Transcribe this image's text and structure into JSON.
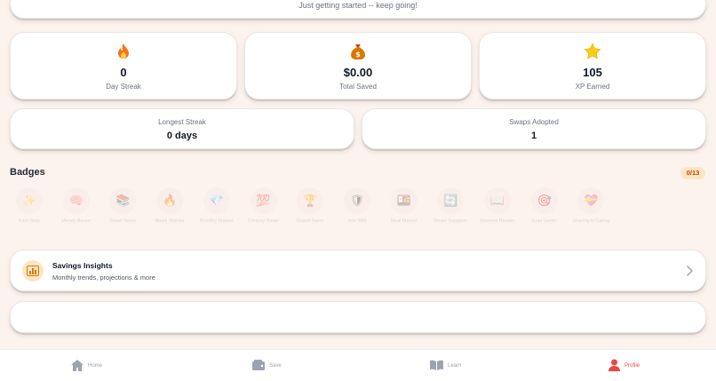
{
  "header": {
    "message": "Just getting started -- keep going!"
  },
  "stats": [
    {
      "icon": "flame-icon",
      "value": "0",
      "label": "Day Streak"
    },
    {
      "icon": "money-bag-icon",
      "value": "$0.00",
      "label": "Total Saved"
    },
    {
      "icon": "star-icon",
      "value": "105",
      "label": "XP Earned"
    }
  ],
  "longest_streak": {
    "label": "Longest Streak",
    "value": "0 days"
  },
  "swaps_adopted": {
    "label": "Swaps Adopted",
    "value": "1"
  },
  "badges": {
    "title": "Badges",
    "count": "0/13",
    "items": [
      {
        "name": "First Step",
        "icon": "sparkle-wand-icon"
      },
      {
        "name": "Money Aware",
        "icon": "brain-icon"
      },
      {
        "name": "Smart Saver",
        "icon": "books-icon"
      },
      {
        "name": "Week Warrior",
        "icon": "flame-icon"
      },
      {
        "name": "Monthly Master",
        "icon": "diamond-icon"
      },
      {
        "name": "Century Saver",
        "icon": "hundred-icon"
      },
      {
        "name": "Grand Saver",
        "icon": "trophy-icon"
      },
      {
        "name": "Iron Will",
        "icon": "shield-icon"
      },
      {
        "name": "Meal Master",
        "icon": "bento-icon"
      },
      {
        "name": "Smart Swapper",
        "icon": "swap-icon"
      },
      {
        "name": "Moment Reader",
        "icon": "book-icon"
      },
      {
        "name": "Goal Getter",
        "icon": "target-icon"
      },
      {
        "name": "Sharing is Caring",
        "icon": "heart-icon"
      }
    ]
  },
  "insights": {
    "title": "Savings Insights",
    "subtitle": "Monthly trends, projections & more"
  },
  "nav": {
    "home": "Home",
    "save": "Save",
    "learn": "Learn",
    "profile": "Profile"
  },
  "colors": {
    "accent": "#ef4444",
    "badge_bg": "#fde6c4",
    "page_bg": "#fdf3ee"
  }
}
